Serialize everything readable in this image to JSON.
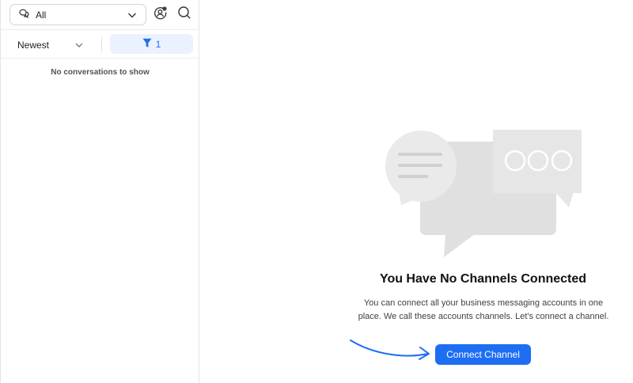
{
  "sidebar": {
    "inbox_filter": {
      "value": "All",
      "icon": "chat-bubbles-icon"
    },
    "sort": {
      "value": "Newest"
    },
    "filter_chip": {
      "count": "1",
      "icon": "funnel-icon"
    },
    "empty_message": "No conversations to show"
  },
  "main": {
    "empty_state": {
      "title": "You Have No Channels Connected",
      "description": "You can connect all your business messaging accounts in one place. We call these accounts channels. Let's connect a channel.",
      "cta_label": "Connect Channel"
    }
  },
  "colors": {
    "accent": "#1d6ef2",
    "chip_bg": "#ebf2ff",
    "illustration_gray": "#e2e2e2"
  }
}
